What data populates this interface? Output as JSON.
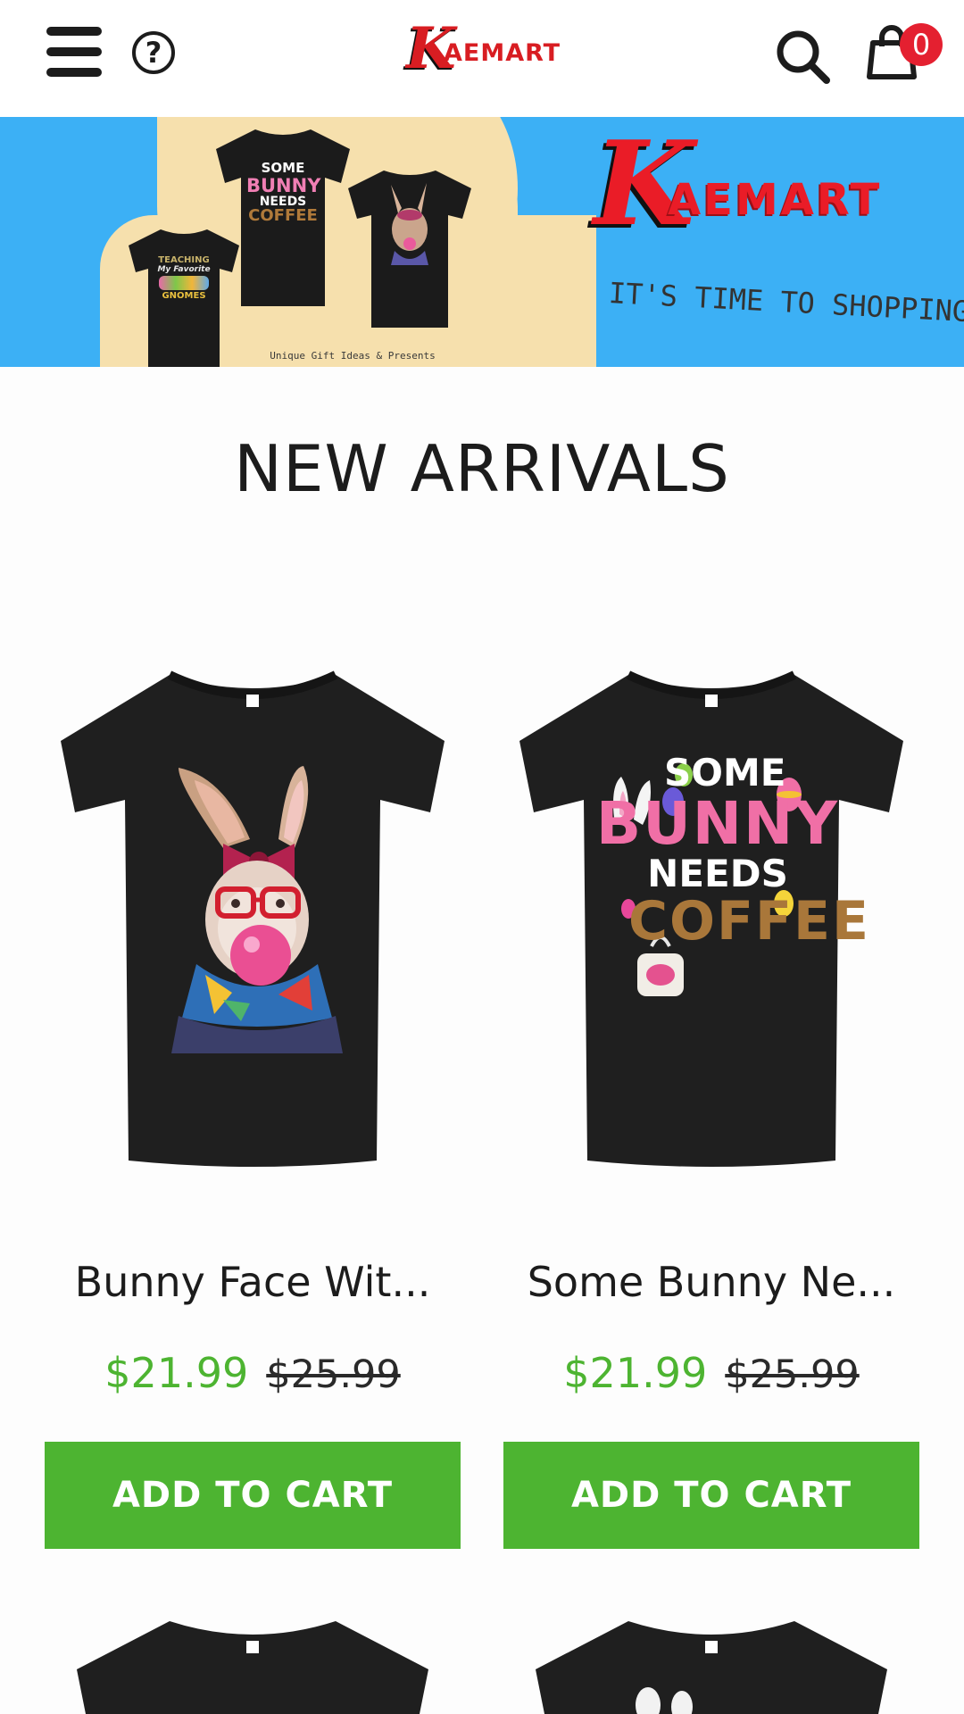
{
  "header": {
    "logo": {
      "letter": "K",
      "rest": "AEMART"
    },
    "cart_count": "0",
    "icons": [
      "menu-icon",
      "help-icon",
      "search-icon",
      "shopping-bag-icon"
    ]
  },
  "banner": {
    "logo": {
      "letter": "K",
      "rest": "AEMART"
    },
    "slogan": "IT'S TIME TO SHOPPING",
    "caption": "Unique Gift Ideas & Presents",
    "colors": {
      "background": "#3cb0f5",
      "cloud": "#f6e0ad",
      "brand_red": "#ea1c27"
    },
    "tees": [
      {
        "lines": [
          "TEACHING",
          "My Favorite",
          "GNOMES"
        ]
      },
      {
        "lines": [
          "SOME",
          "BUNNY",
          "NEEDS",
          "COFFEE"
        ]
      },
      {
        "lines": []
      }
    ]
  },
  "section_title": "NEW ARRIVALS",
  "products": [
    {
      "name": "Bunny Face Wit...",
      "price": "$21.99",
      "old_price": "$25.99",
      "button": "ADD TO CART",
      "design": "bunny-with-glasses-bubblegum"
    },
    {
      "name": "Some Bunny Ne...",
      "price": "$21.99",
      "old_price": "$25.99",
      "button": "ADD TO CART",
      "design": "some-bunny-needs-coffee",
      "print_lines": [
        "SOME",
        "BUNNY",
        "NEEDS",
        "COFFEE"
      ]
    }
  ],
  "colors": {
    "accent_green": "#4db431",
    "badge_red": "#e42030",
    "text": "#1c1c1c"
  }
}
